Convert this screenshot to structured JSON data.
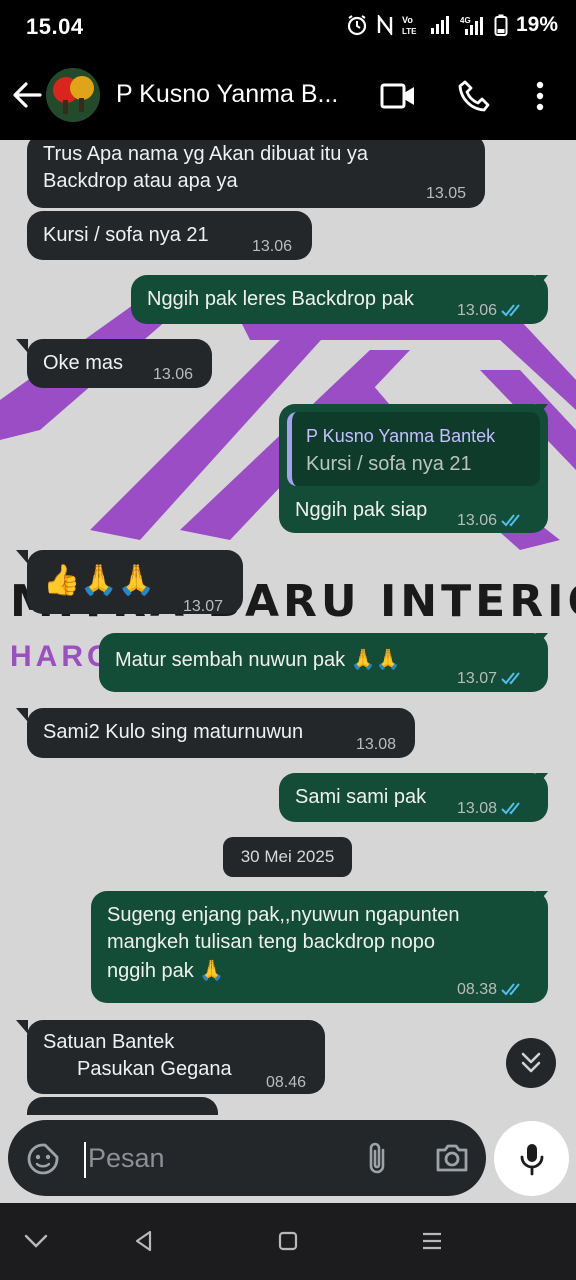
{
  "status": {
    "time": "15.04",
    "battery": "19%",
    "network": "4G"
  },
  "header": {
    "title": "P Kusno Yanma B...",
    "icons": [
      "back-arrow-icon",
      "video-call-icon",
      "phone-icon",
      "more-options-icon"
    ]
  },
  "watermark": {
    "text": "MITRA BARU INTERIOR",
    "subtext": "HARGA ... AN"
  },
  "messages": [
    {
      "dir": "in",
      "text1": "Trus Apa nama yg Akan dibuat itu ya",
      "text2": "Backdrop atau apa ya",
      "time": "13.05"
    },
    {
      "dir": "in",
      "text": "Kursi / sofa nya 21",
      "time": "13.06"
    },
    {
      "dir": "out",
      "text": "Nggih pak leres Backdrop pak",
      "time": "13.06"
    },
    {
      "dir": "in",
      "text": "Oke mas",
      "time": "13.06"
    },
    {
      "dir": "out",
      "quote_name": "P Kusno Yanma Bantek",
      "quote_text": "Kursi / sofa nya 21",
      "text": "Nggih pak siap",
      "time": "13.06"
    },
    {
      "dir": "in",
      "text": "👍🙏🙏",
      "time": "13.07"
    },
    {
      "dir": "out",
      "text": "Matur sembah nuwun pak 🙏🙏",
      "time": "13.07"
    },
    {
      "dir": "in",
      "text": "Sami2 Kulo sing maturnuwun",
      "time": "13.08"
    },
    {
      "dir": "out",
      "text": "Sami sami pak",
      "time": "13.08"
    },
    {
      "dir": "out",
      "text1": "Sugeng enjang pak,,nyuwun ngapunten",
      "text2": "mangkeh tulisan teng backdrop nopo",
      "text3": "nggih pak 🙏",
      "time": "08.38"
    },
    {
      "dir": "in",
      "text1": "Satuan Bantek",
      "text2": "Pasukan Gegana",
      "time": "08.46"
    }
  ],
  "date_chip": "30 Mei 2025",
  "input": {
    "placeholder": "Pesan"
  },
  "colors": {
    "incoming": "#23272a",
    "outgoing": "#134d37",
    "read_ticks": "#53bdeb",
    "chat_bg": "#d6d6d6"
  }
}
